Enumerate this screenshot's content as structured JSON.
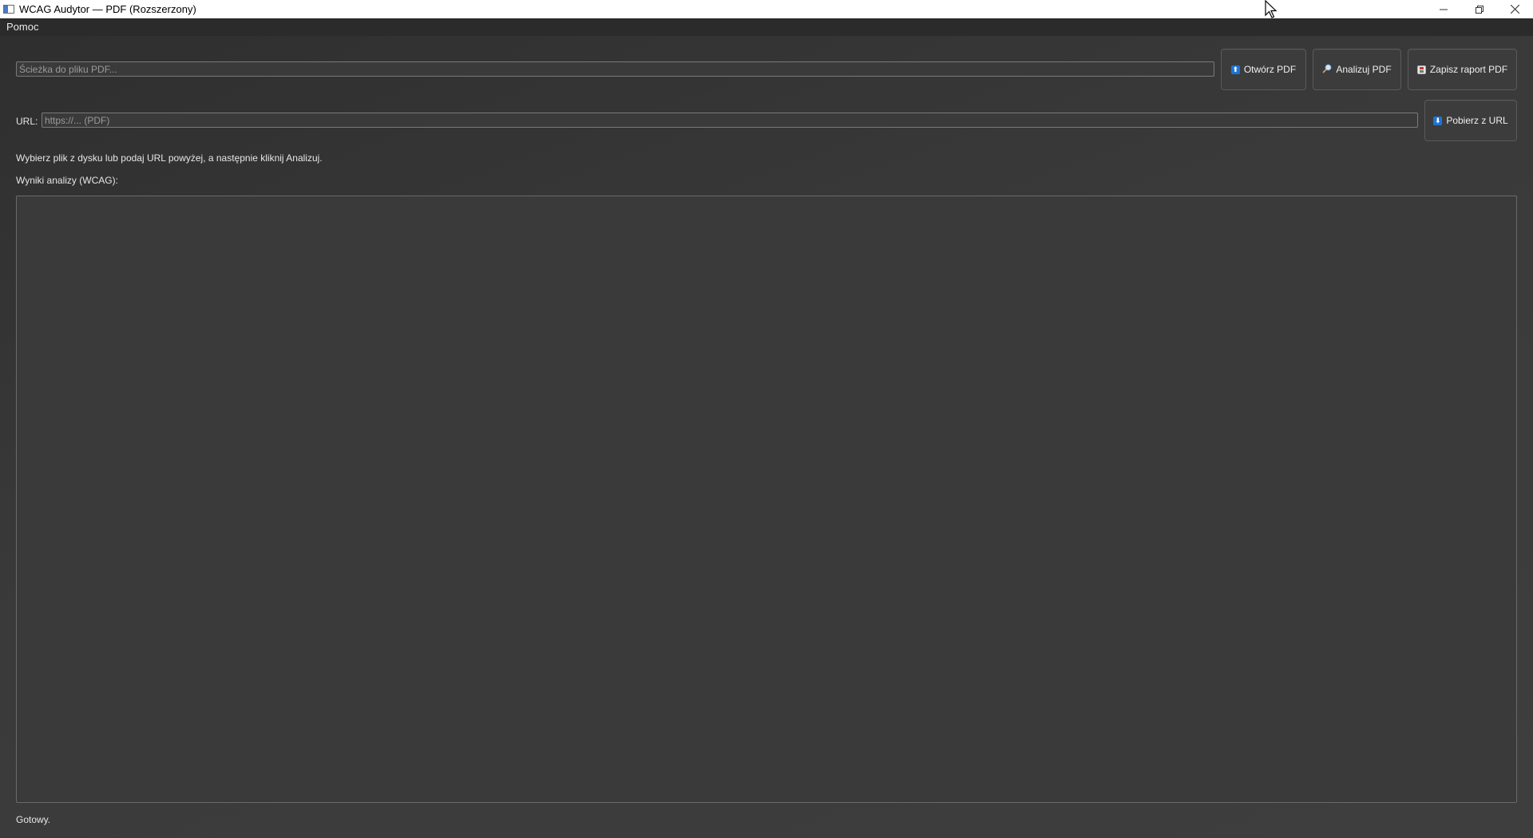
{
  "window": {
    "title": "WCAG Audytor — PDF (Rozszerzony)"
  },
  "menu": {
    "items": [
      "Pomoc"
    ]
  },
  "file_row": {
    "path_value": "",
    "path_placeholder": "Ścieżka do pliku PDF...",
    "open_button": "Otwórz PDF",
    "analyze_button": "Analizuj PDF",
    "save_button": "Zapisz raport PDF"
  },
  "url_row": {
    "label": "URL:",
    "url_value": "",
    "url_placeholder": "https://... (PDF)",
    "fetch_button": "Pobierz z URL"
  },
  "instructions": "Wybierz plik z dysku lub podaj URL powyżej, a następnie kliknij Analizuj.",
  "results": {
    "label": "Wyniki analizy (WCAG):",
    "content": ""
  },
  "status": {
    "text": "Gotowy."
  },
  "icons": {
    "open": "folder-upload-icon",
    "analyze": "magnifier-icon",
    "save": "floppy-disk-icon",
    "fetch": "download-icon"
  },
  "colors": {
    "accent_icon": "#1e74d6",
    "background": "#3a3a3a",
    "titlebar": "#ffffff"
  }
}
